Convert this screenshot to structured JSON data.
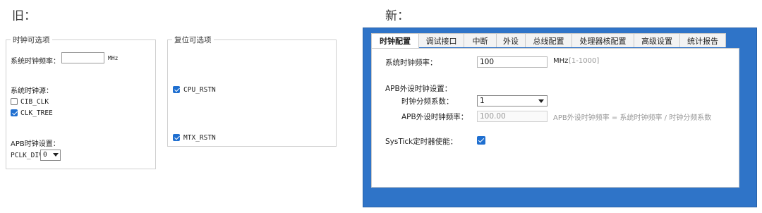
{
  "old": {
    "heading": "旧：",
    "clock_group": {
      "title": "时钟可选项",
      "freq_label": "系统时钟频率：",
      "freq_value": "",
      "freq_unit": "MHz",
      "source_label": "系统时钟源：",
      "sources": [
        {
          "label": "CIB_CLK",
          "checked": false
        },
        {
          "label": "CLK_TREE",
          "checked": true
        }
      ],
      "apb_label": "APB时钟设置：",
      "pclk_label": "PCLK_DIV",
      "pclk_value": "0"
    },
    "reset_group": {
      "title": "复位可选项",
      "items": [
        {
          "label": "CPU_RSTN",
          "checked": true
        },
        {
          "label": "MTX_RSTN",
          "checked": true
        }
      ]
    }
  },
  "new": {
    "heading": "新：",
    "tabs": [
      "时钟配置",
      "调试接口",
      "中断",
      "外设",
      "总线配置",
      "处理器核配置",
      "高级设置",
      "统计报告"
    ],
    "active_tab": 0,
    "sys_freq_label": "系统时钟频率：",
    "sys_freq_value": "100",
    "sys_freq_unit": "MHz",
    "sys_freq_range": "[1-1000]",
    "apb_section_label": "APB外设时钟设置：",
    "div_label": "时钟分频系数：",
    "div_value": "1",
    "apb_freq_label": "APB外设时钟频率：",
    "apb_freq_value": "100.00",
    "apb_formula": "APB外设时钟频率 = 系统时钟频率 / 时钟分频系数",
    "systick_label": "SysTick定时器使能：",
    "systick_enabled": true
  },
  "colors": {
    "window_frame": "#2f74c8",
    "checkbox": "#1f6fd0"
  }
}
